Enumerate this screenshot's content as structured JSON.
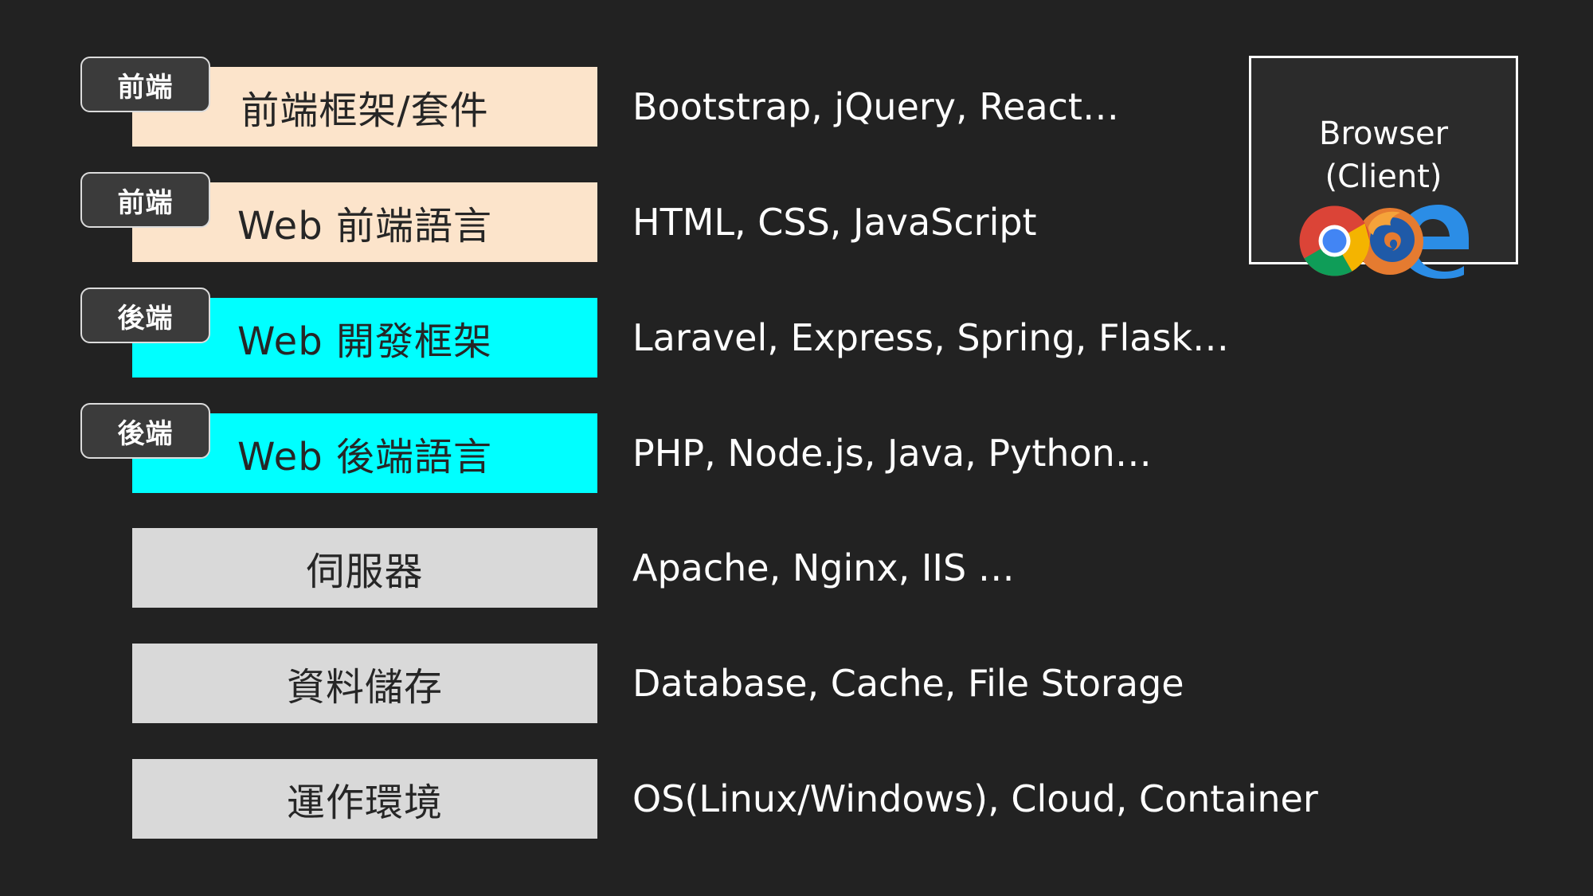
{
  "layers": [
    {
      "tag": "前端",
      "label": "前端框架/套件",
      "examples": "Bootstrap, jQuery, React…",
      "category": "frontend"
    },
    {
      "tag": "前端",
      "label": "Web 前端語言",
      "examples": "HTML, CSS, JavaScript",
      "category": "frontend"
    },
    {
      "tag": "後端",
      "label": "Web 開發框架",
      "examples": "Laravel, Express, Spring, Flask…",
      "category": "backend"
    },
    {
      "tag": "後端",
      "label": "Web 後端語言",
      "examples": "PHP, Node.js, Java, Python…",
      "category": "backend"
    },
    {
      "label": "伺服器",
      "examples": "Apache, Nginx, IIS …",
      "category": "infrastructure"
    },
    {
      "label": "資料儲存",
      "examples": "Database, Cache, File Storage",
      "category": "infrastructure"
    },
    {
      "label": "運作環境",
      "examples": "OS(Linux/Windows), Cloud, Container",
      "category": "infrastructure"
    }
  ],
  "browser": {
    "line1": "Browser",
    "line2": "(Client)",
    "icons": [
      "chrome-icon",
      "firefox-icon",
      "edge-icon"
    ]
  },
  "colors": {
    "background": "#222222",
    "frontend": "#fce4cb",
    "backend": "#00ffff",
    "infrastructure": "#d9d9d9",
    "tag_fill": "#3b3b3b",
    "text_light": "#ffffff",
    "text_dark": "#262626"
  }
}
